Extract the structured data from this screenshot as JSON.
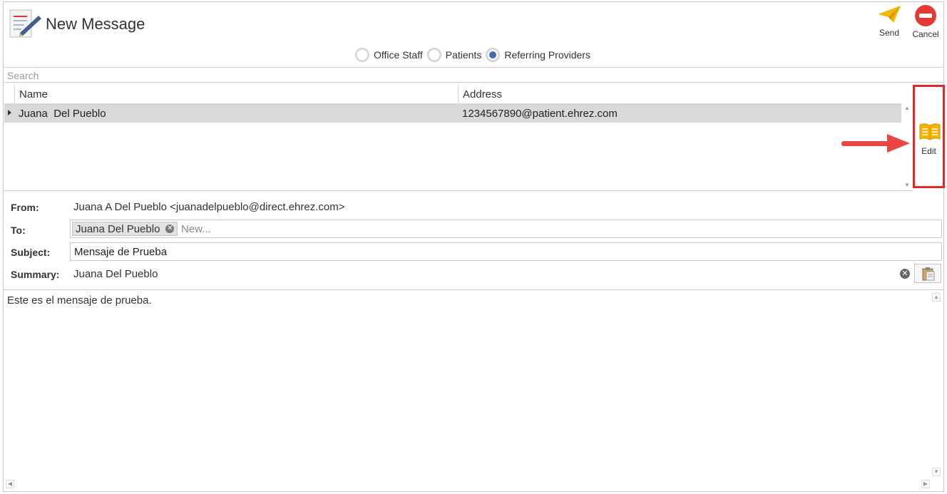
{
  "window": {
    "title": "New Message"
  },
  "toolbar": {
    "send_label": "Send",
    "cancel_label": "Cancel"
  },
  "recipient_types": [
    {
      "label": "Office Staff",
      "selected": false
    },
    {
      "label": "Patients",
      "selected": false
    },
    {
      "label": "Referring Providers",
      "selected": true
    }
  ],
  "search": {
    "placeholder": "Search"
  },
  "contacts": {
    "columns": [
      "Name",
      "Address"
    ],
    "rows": [
      {
        "name": "Juana  Del Pueblo",
        "address": "1234567890@patient.ehrez.com"
      }
    ]
  },
  "side": {
    "edit_label": "Edit"
  },
  "form": {
    "from_label": "From:",
    "from_value": "Juana A Del Pueblo <juanadelpueblo@direct.ehrez.com>",
    "to_label": "To:",
    "to_chip": "Juana Del Pueblo",
    "to_placeholder": "New...",
    "subject_label": "Subject:",
    "subject_value": "Mensaje de Prueba",
    "summary_label": "Summary:",
    "summary_value": "Juana Del Pueblo"
  },
  "body": {
    "text": "Este es el mensaje de prueba."
  },
  "colors": {
    "accent_blue": "#3e6fb0",
    "highlight_red": "#e02a2a",
    "send_yellow": "#f2b800",
    "cancel_red": "#e53935"
  },
  "icons": [
    "notepad-pencil-icon",
    "paper-plane-icon",
    "no-entry-icon",
    "open-book-icon",
    "clipboard-icon",
    "clear-icon"
  ]
}
